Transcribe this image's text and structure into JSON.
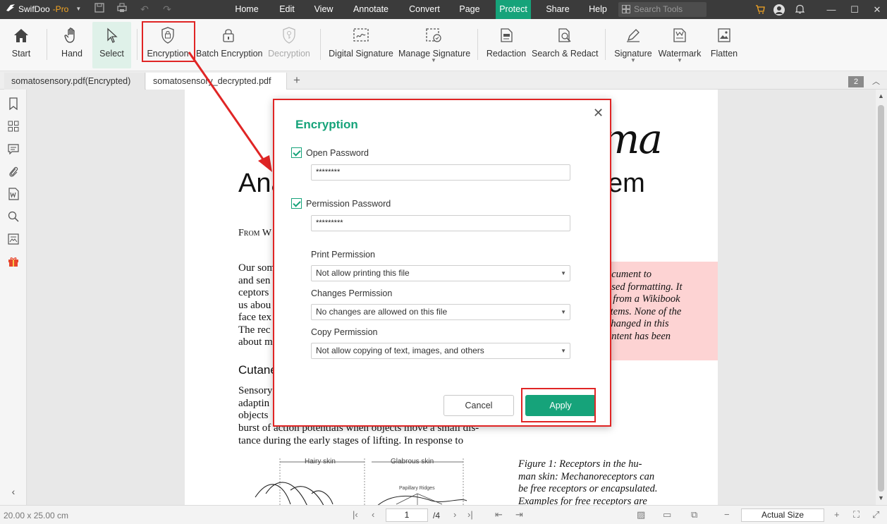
{
  "app": {
    "name": "SwifDoo",
    "edition": "-Pro"
  },
  "menu": [
    "Home",
    "Edit",
    "View",
    "Annotate",
    "Convert",
    "Page",
    "Protect",
    "Share",
    "Help"
  ],
  "search_placeholder": "Search Tools",
  "toolbar": {
    "start": "Start",
    "hand": "Hand",
    "select": "Select",
    "encryption": "Encryption",
    "batch_encryption": "Batch Encryption",
    "decryption": "Decryption",
    "digital_signature": "Digital Signature",
    "manage_signature": "Manage Signature",
    "redaction": "Redaction",
    "search_redact": "Search & Redact",
    "signature": "Signature",
    "watermark": "Watermark",
    "flatten": "Flatten"
  },
  "tabs": [
    "somatosensory.pdf(Encrypted)",
    "somatosensory_decrypted.pdf"
  ],
  "tab_count": "2",
  "document": {
    "script_title": "uma",
    "title_left": "Ana",
    "title_right": "em",
    "from": "From W",
    "para1": [
      "Our som",
      "and sen",
      "ceptors",
      "us abou",
      "face tex",
      "The rec",
      "about m"
    ],
    "heading2": "Cutane",
    "para2": [
      "Sensory",
      "adaptin",
      "objects"
    ],
    "para2_tail": [
      "burst of action potentials when objects move a small dis-",
      "tance during the early stages of lifting. In response to"
    ],
    "pink_lines": [
      "ocument to",
      "ased formatting. It",
      "r from a Wikibook",
      "stems. None of the",
      "changed in this",
      "ontent has been"
    ],
    "caption": [
      "Figure 1:  Receptors in the hu-",
      "man skin: Mechanoreceptors can",
      "be free receptors or encapsulated.",
      "Examples for free receptors are"
    ],
    "fig_hairy": "Hairy skin",
    "fig_glabrous": "Glabrous skin",
    "fig_papillary": "Papillary Ridges"
  },
  "dialog": {
    "title": "Encryption",
    "open_password_label": "Open Password",
    "open_password_value": "********",
    "permission_password_label": "Permission Password",
    "permission_password_value": "*********",
    "print_label": "Print Permission",
    "print_value": "Not allow printing this file",
    "changes_label": "Changes Permission",
    "changes_value": "No changes are allowed on this file",
    "copy_label": "Copy Permission",
    "copy_value": "Not allow copying of text, images, and others",
    "cancel": "Cancel",
    "apply": "Apply"
  },
  "status": {
    "dimensions": "20.00 x 25.00 cm",
    "current_page": "1",
    "total_pages": "/4",
    "zoom": "Actual Size"
  },
  "colors": {
    "accent": "#16a37a",
    "highlight": "#e02525",
    "titlebar": "#3b3b3b"
  }
}
